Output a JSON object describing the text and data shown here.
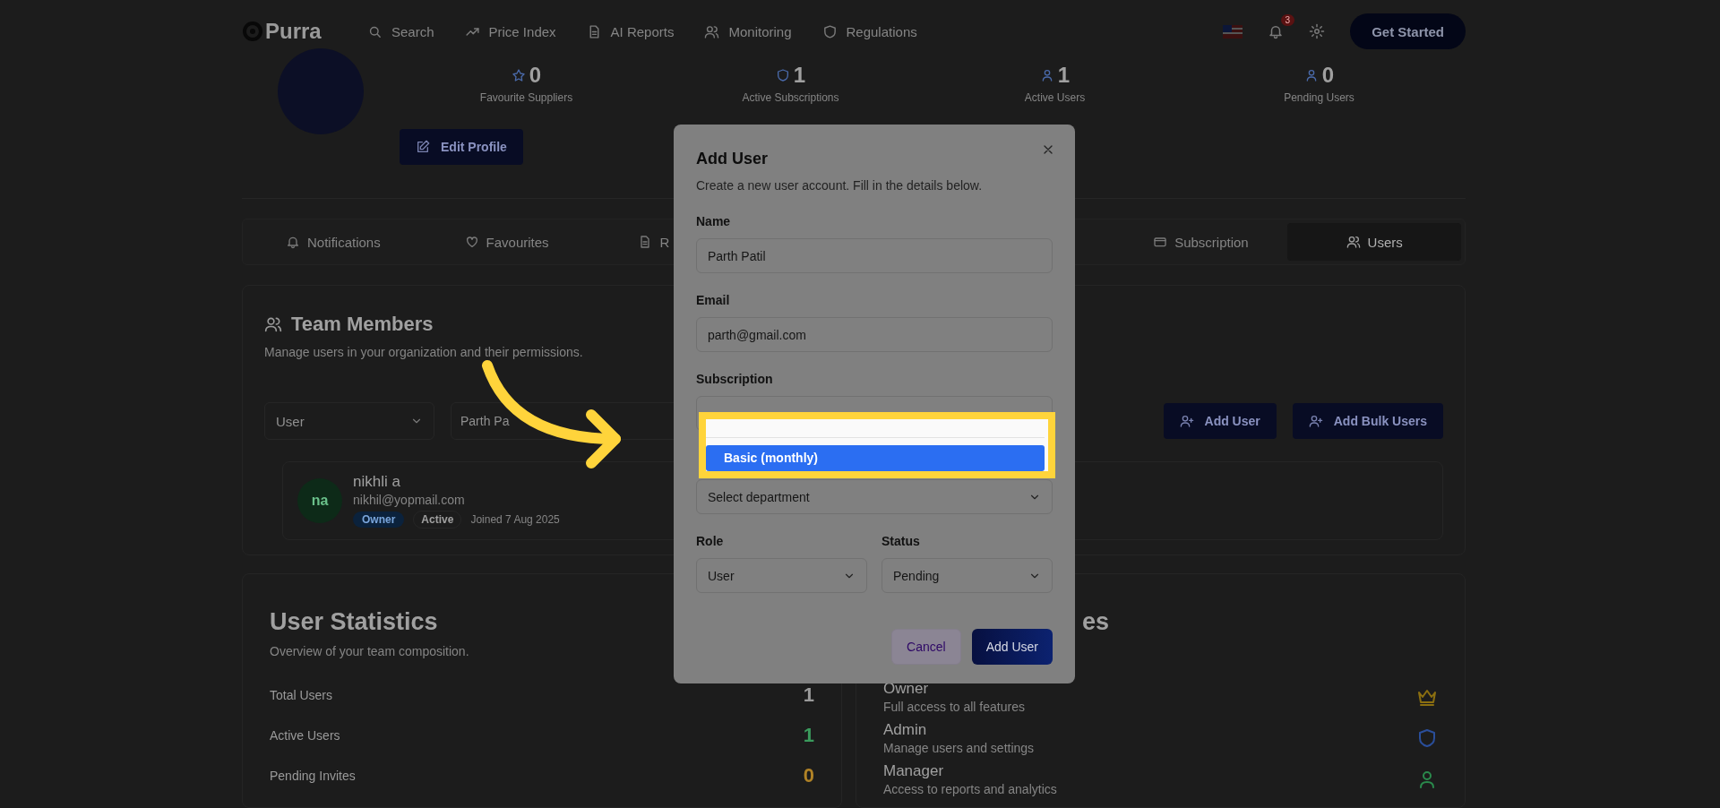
{
  "header": {
    "logo": "Purra",
    "nav": [
      {
        "label": "Search"
      },
      {
        "label": "Price Index"
      },
      {
        "label": "AI Reports"
      },
      {
        "label": "Monitoring"
      },
      {
        "label": "Regulations"
      }
    ],
    "notification_count": "3",
    "cta": "Get Started"
  },
  "profile": {
    "stats": [
      {
        "value": "0",
        "label": "Favourite Suppliers"
      },
      {
        "value": "1",
        "label": "Active Subscriptions"
      },
      {
        "value": "1",
        "label": "Active Users"
      },
      {
        "value": "0",
        "label": "Pending Users"
      }
    ],
    "edit_button": "Edit Profile"
  },
  "tabs": [
    {
      "label": "Notifications",
      "selected": false
    },
    {
      "label": "Favourites",
      "selected": false
    },
    {
      "label": "R",
      "selected": false
    },
    {
      "label": "Subscription",
      "selected": false
    },
    {
      "label": "Users",
      "selected": true
    }
  ],
  "team": {
    "title": "Team Members",
    "subtitle": "Manage users in your organization and their permissions.",
    "filters": [
      {
        "kind": "select",
        "value": "User"
      },
      {
        "kind": "input",
        "value": "Parth Pa"
      }
    ],
    "buttons": [
      "Add User",
      "Add Bulk Users"
    ],
    "members": [
      {
        "initials": "na",
        "name": "nikhli a",
        "email": "nikhil@yopmail.com",
        "role": "Owner",
        "status": "Active",
        "joined": "Joined 7 Aug 2025"
      }
    ]
  },
  "user_statistics": {
    "title": "User Statistics",
    "subtitle": "Overview of your team composition.",
    "rows": [
      {
        "label": "Total Users",
        "value": "1",
        "color": "#9a9a9a"
      },
      {
        "label": "Active Users",
        "value": "1",
        "color": "#3a9a5c"
      },
      {
        "label": "Pending Invites",
        "value": "0",
        "color": "#b08226"
      }
    ]
  },
  "roles": {
    "title": "es",
    "items": [
      {
        "name": "Owner",
        "description": "Full access to all features"
      },
      {
        "name": "Admin",
        "description": "Manage users and settings"
      },
      {
        "name": "Manager",
        "description": "Access to reports and analytics"
      }
    ]
  },
  "dialog": {
    "title": "Add User",
    "subtitle": "Create a new user account. Fill in the details below.",
    "name_label": "Name",
    "name_value": "Parth Patil",
    "email_label": "Email",
    "email_value": "parth@gmail.com",
    "subscription_label": "Subscription",
    "subscription_options": [
      {
        "label": "Basic (monthly)",
        "selected": true
      }
    ],
    "department_placeholder": "Select department",
    "role_label": "Role",
    "role_value": "User",
    "status_label": "Status",
    "status_value": "Pending",
    "cancel": "Cancel",
    "submit": "Add User"
  }
}
